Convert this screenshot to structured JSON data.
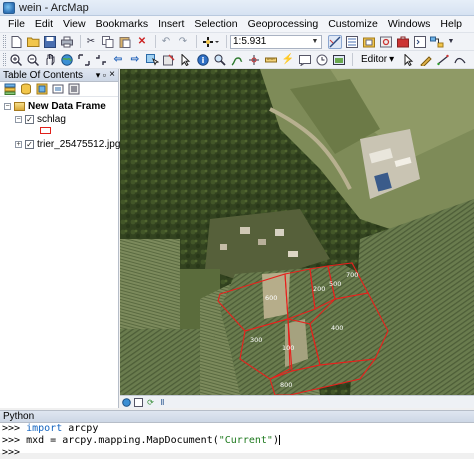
{
  "window": {
    "title": "wein - ArcMap"
  },
  "menu": [
    "File",
    "Edit",
    "View",
    "Bookmarks",
    "Insert",
    "Selection",
    "Geoprocessing",
    "Customize",
    "Windows",
    "Help"
  ],
  "toolbar": {
    "scale_value": "1:5.931",
    "editor_label": "Editor",
    "editor_arrow": "▾"
  },
  "toc": {
    "title": "Table Of Contents",
    "pin_glyph": "▾ ▫",
    "close_glyph": "×",
    "data_frame": "New Data Frame",
    "layers": [
      {
        "name": "schlag",
        "checked": true,
        "expanded": true
      },
      {
        "name": "trier_25475512.jpg",
        "checked": true,
        "expanded": false
      }
    ],
    "expander_expanded": "−",
    "expander_collapsed": "+",
    "check_glyph": "✓"
  },
  "map": {
    "parcel_labels": [
      "700",
      "600",
      "500",
      "200",
      "400",
      "300",
      "100",
      "800"
    ],
    "outline_color": "#e8201c"
  },
  "python": {
    "title": "Python",
    "lines": [
      {
        "prompt": ">>>",
        "keyword": "import",
        "rest": " arcpy"
      },
      {
        "prompt": ">>>",
        "code_before": " mxd = arcpy.mapping.MapDocument(",
        "string": "\"Current\"",
        "code_after": ")"
      },
      {
        "prompt": ">>>"
      }
    ]
  },
  "icons": {
    "new": "new-document-icon",
    "open": "open-folder-icon",
    "save": "save-icon",
    "print": "print-icon",
    "cut": "cut-icon",
    "copy": "copy-icon",
    "paste": "paste-icon",
    "delete": "delete-icon",
    "undo": "undo-icon",
    "redo": "redo-icon",
    "add-data": "add-data-icon"
  }
}
